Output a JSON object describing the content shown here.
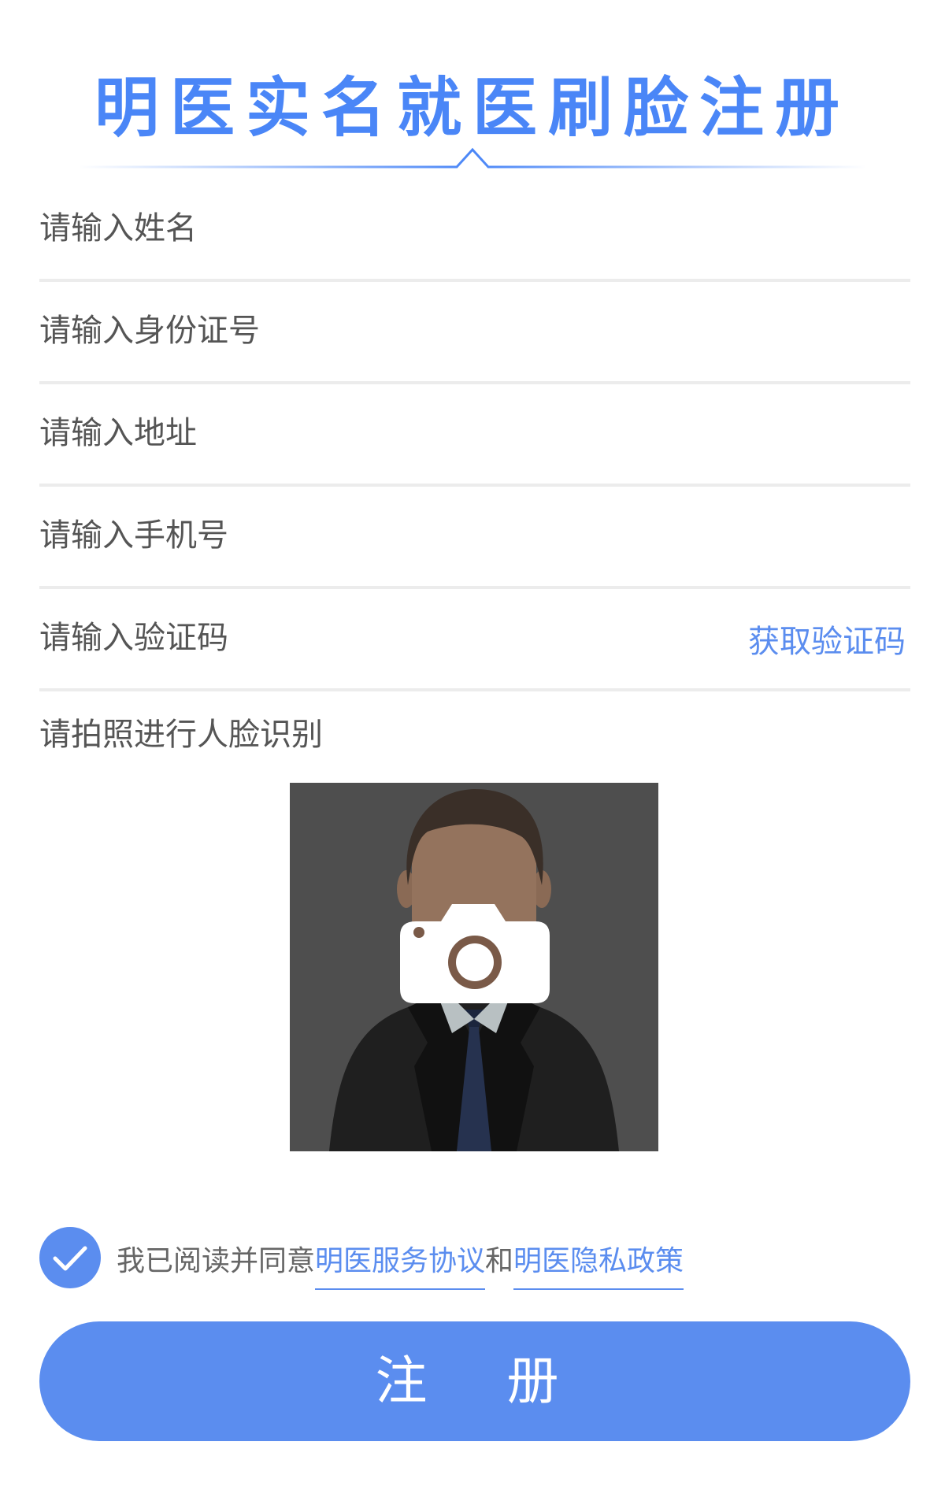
{
  "header": {
    "title": "明医实名就医刷脸注册"
  },
  "form": {
    "name_placeholder": "请输入姓名",
    "id_placeholder": "请输入身份证号",
    "address_placeholder": "请输入地址",
    "phone_placeholder": "请输入手机号",
    "code_placeholder": "请输入验证码",
    "get_code_label": "获取验证码"
  },
  "face": {
    "label": "请拍照进行人脸识别",
    "icon": "camera-icon"
  },
  "agreement": {
    "checked": true,
    "prefix": "我已阅读并同意",
    "service_link": "明医服务协议",
    "conjunction": "和",
    "privacy_link": "明医隐私政策"
  },
  "actions": {
    "register_label": "注 册"
  },
  "colors": {
    "accent": "#5b8def",
    "title": "#4a86f7",
    "divider": "#ececec",
    "photo_bg": "#4e4e4e"
  }
}
